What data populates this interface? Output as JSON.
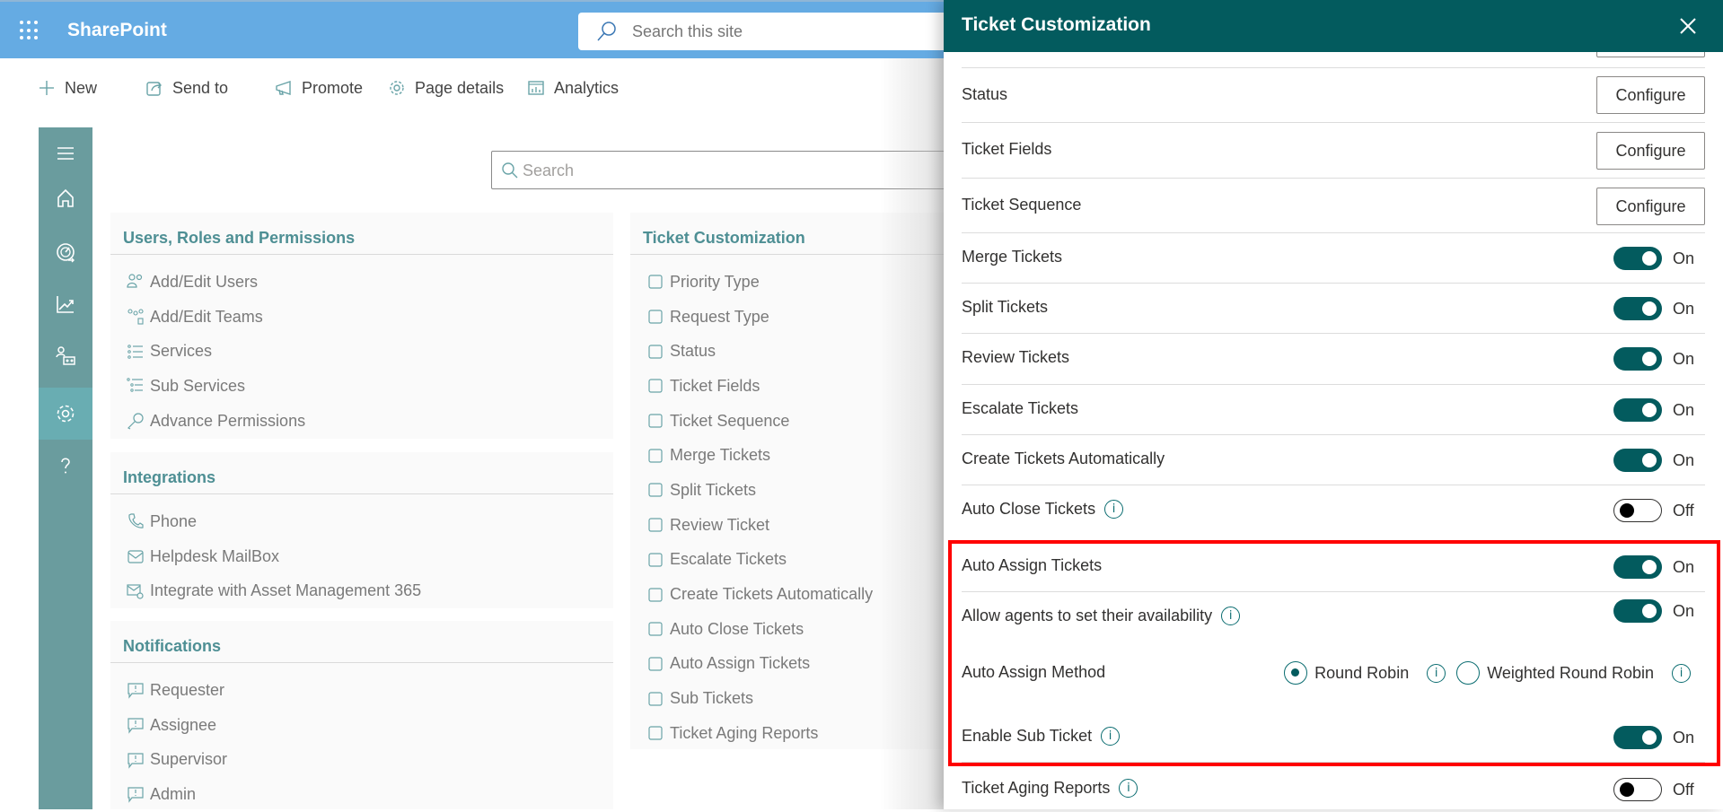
{
  "app": {
    "name": "SharePoint",
    "search_placeholder": "Search this site"
  },
  "command_bar": {
    "items": [
      {
        "label": "New",
        "icon": "plus-icon"
      },
      {
        "label": "Send to",
        "icon": "share-icon"
      },
      {
        "label": "Promote",
        "icon": "megaphone-icon"
      },
      {
        "label": "Page details",
        "icon": "gear-icon"
      },
      {
        "label": "Analytics",
        "icon": "analytics-icon"
      }
    ]
  },
  "left_nav": {
    "items": [
      {
        "name": "menu",
        "icon": "hamburger-icon"
      },
      {
        "name": "home",
        "icon": "home-icon"
      },
      {
        "name": "dashboard",
        "icon": "gauge-icon"
      },
      {
        "name": "reports",
        "icon": "chart-line-icon"
      },
      {
        "name": "agents",
        "icon": "people-icon"
      },
      {
        "name": "settings",
        "icon": "gear-icon",
        "selected": true
      },
      {
        "name": "help",
        "icon": "question-icon"
      }
    ]
  },
  "main": {
    "search_placeholder": "Search",
    "sections": {
      "users": {
        "title": "Users, Roles and Permissions",
        "items": [
          "Add/Edit Users",
          "Add/Edit Teams",
          "Services",
          "Sub Services",
          "Advance Permissions"
        ]
      },
      "integrations": {
        "title": "Integrations",
        "items": [
          "Phone",
          "Helpdesk MailBox",
          "Integrate with Asset Management 365"
        ]
      },
      "notifications": {
        "title": "Notifications",
        "items": [
          "Requester",
          "Assignee",
          "Supervisor",
          "Admin"
        ]
      },
      "ticket_customization": {
        "title": "Ticket Customization",
        "items": [
          "Priority Type",
          "Request Type",
          "Status",
          "Ticket Fields",
          "Ticket Sequence",
          "Merge Tickets",
          "Split Tickets",
          "Review Ticket",
          "Escalate Tickets",
          "Create Tickets Automatically",
          "Auto Close Tickets",
          "Auto Assign Tickets",
          "Sub Tickets",
          "Ticket Aging Reports"
        ]
      }
    }
  },
  "panel": {
    "title": "Ticket Customization",
    "configure_label": "Configure",
    "configure_rows": [
      {
        "label": "Status"
      },
      {
        "label": "Ticket Fields"
      },
      {
        "label": "Ticket Sequence"
      }
    ],
    "toggle_rows": [
      {
        "label": "Merge Tickets",
        "state": "On",
        "on": true,
        "info": false
      },
      {
        "label": "Split Tickets",
        "state": "On",
        "on": true,
        "info": false
      },
      {
        "label": "Review Tickets",
        "state": "On",
        "on": true,
        "info": false
      },
      {
        "label": "Escalate Tickets",
        "state": "On",
        "on": true,
        "info": false
      },
      {
        "label": "Create Tickets Automatically",
        "state": "On",
        "on": true,
        "info": false
      },
      {
        "label": "Auto Close Tickets",
        "state": "Off",
        "on": false,
        "info": true
      }
    ],
    "auto_assign": {
      "label": "Auto Assign Tickets",
      "state": "On",
      "availability_label": "Allow agents to set their availability",
      "availability_state": "On",
      "method_label": "Auto Assign Method",
      "methods": [
        {
          "label": "Round Robin",
          "selected": true
        },
        {
          "label": "Weighted Round Robin",
          "selected": false
        }
      ]
    },
    "bottom_rows": [
      {
        "label": "Enable Sub Ticket",
        "state": "On",
        "on": true
      },
      {
        "label": "Ticket Aging Reports",
        "state": "Off",
        "on": false
      }
    ],
    "info_glyph": "i"
  },
  "colors": {
    "topbar": "#65ABE3",
    "panel_header": "#035B5E",
    "accent": "#035B5E",
    "nav": "#6A9C9E",
    "nav_selected": "#69ADB2",
    "section_title": "#4E8F94",
    "highlight": "#FF0000"
  }
}
